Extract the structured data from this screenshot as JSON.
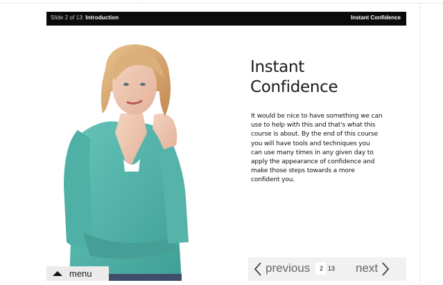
{
  "header": {
    "slide_prefix": "Slide 2 of 13: ",
    "section": "Introduction",
    "title": "Instant Confidence"
  },
  "content": {
    "heading_line1": "Instant",
    "heading_line2": "Confidence",
    "body": "It would be nice to have something we can use to help with this and that's what this course is about. By the end of this course you will have tools and techniques you can use many times in any given day to apply the appearance of confidence and make those steps towards a more confident you."
  },
  "footer": {
    "menu_label": "menu",
    "previous_label": "previous",
    "next_label": "next",
    "current_page": "2",
    "total_pages": "13"
  },
  "colors": {
    "title_bar": "#0b0b0b",
    "sweater": "#5ab8ae",
    "nav_bg": "#f1f1f1"
  }
}
